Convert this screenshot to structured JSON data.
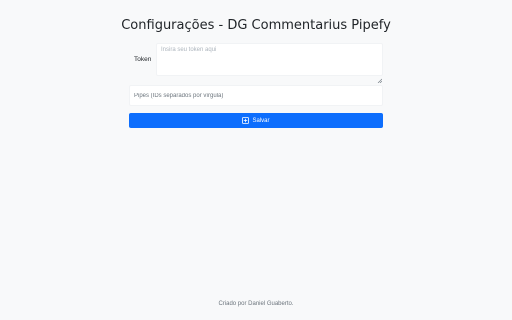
{
  "page": {
    "title": "Configurações - DG Commentarius Pipefy"
  },
  "form": {
    "token": {
      "label": "Token",
      "placeholder": "Insira seu token aqui",
      "value": ""
    },
    "pipes": {
      "placeholder": "Pipes (IDs separados por vírgula)",
      "value": ""
    },
    "save_button": {
      "label": "Salvar",
      "icon": "plus-square-icon",
      "color": "#0d6efd"
    }
  },
  "footer": {
    "credit": "Criado por Daniel Guaberto."
  },
  "colors": {
    "background": "#f8f9fa",
    "primary": "#0d6efd"
  }
}
